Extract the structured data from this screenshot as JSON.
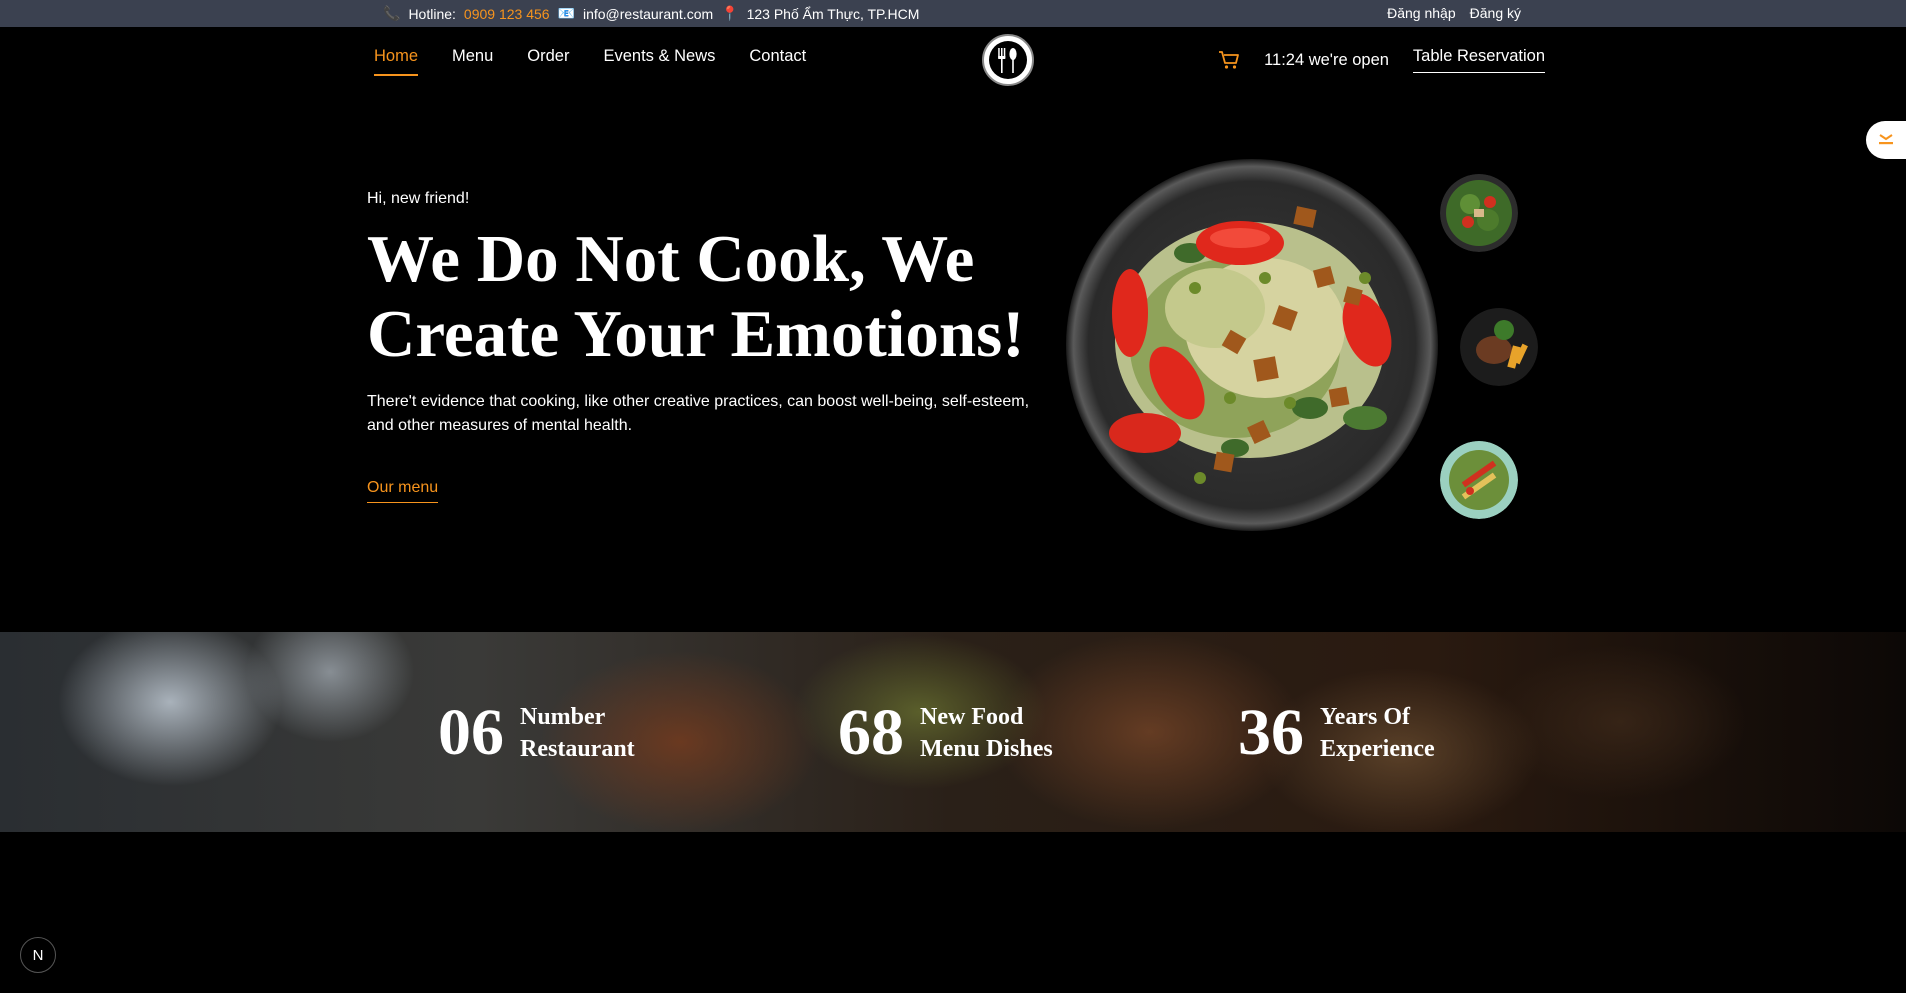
{
  "topbar": {
    "hotline_label": "Hotline:",
    "hotline_number": "0909 123 456",
    "email": "info@restaurant.com",
    "address": "123 Phố Ẩm Thực, TP.HCM",
    "login": "Đăng nhập",
    "register": "Đăng ký"
  },
  "nav": {
    "items": [
      "Home",
      "Menu",
      "Order",
      "Events & News",
      "Contact"
    ],
    "active": "Home"
  },
  "header_right": {
    "status": "11:24 we're open",
    "reservation": "Table Reservation"
  },
  "hero": {
    "greeting": "Hi, new friend!",
    "headline": "We Do Not Cook, We Create Your Emotions!",
    "description": "There't evidence that cooking, like other creative practices, can boost well-being, self-esteem, and other measures of mental health.",
    "cta": "Our menu"
  },
  "stats": [
    {
      "number": "06",
      "label_line1": "Number",
      "label_line2": "Restaurant"
    },
    {
      "number": "68",
      "label_line1": "New Food",
      "label_line2": "Menu Dishes"
    },
    {
      "number": "36",
      "label_line1": "Years Of",
      "label_line2": "Experience"
    }
  ],
  "dev_badge": "N",
  "colors": {
    "accent": "#f7941d",
    "topbar": "#3b4150",
    "background": "#000000"
  }
}
